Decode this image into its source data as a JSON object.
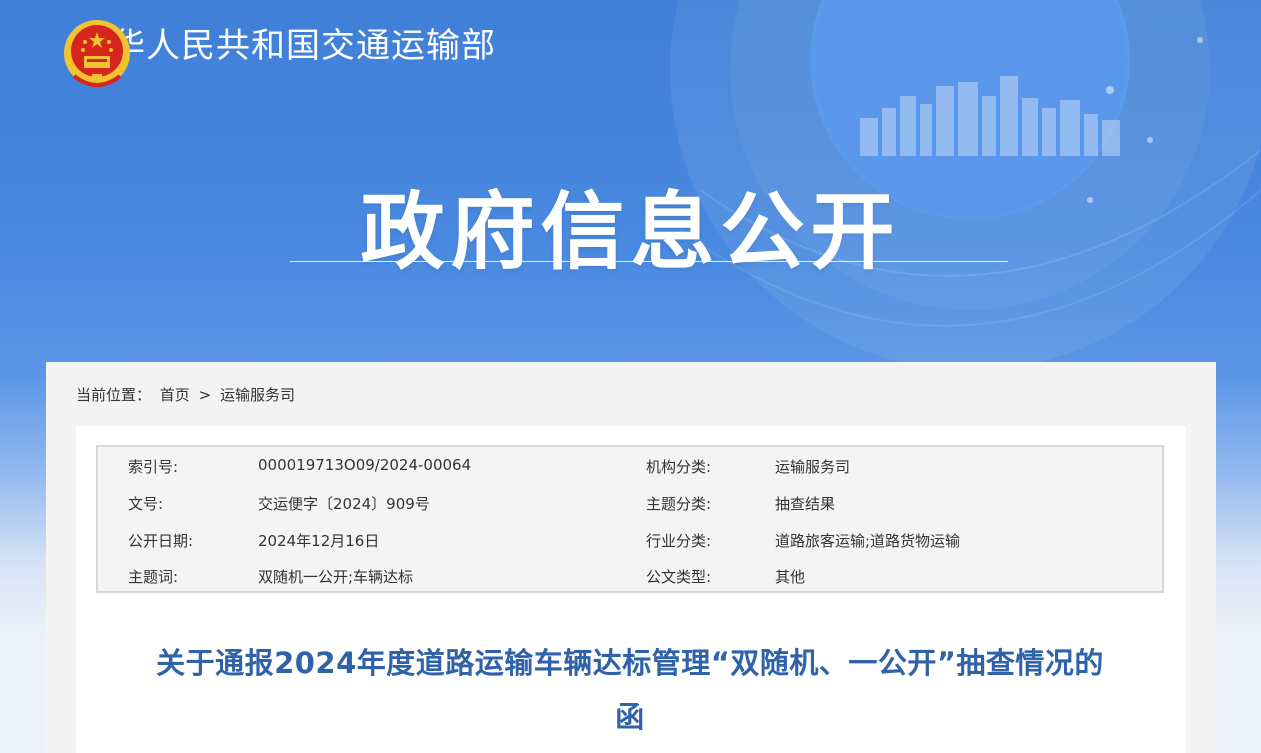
{
  "header": {
    "site_name": "中华人民共和国交通运输部",
    "banner_title": "政府信息公开"
  },
  "breadcrumb": {
    "label": "当前位置：",
    "home": "首页",
    "sep": ">",
    "current": "运输服务司"
  },
  "meta": {
    "rows": [
      {
        "k1": "索引号:",
        "v1": "000019713O09/2024-00064",
        "k2": "机构分类:",
        "v2": "运输服务司"
      },
      {
        "k1": "文号:",
        "v1": "交运便字〔2024〕909号",
        "k2": "主题分类:",
        "v2": "抽查结果"
      },
      {
        "k1": "公开日期:",
        "v1": "2024年12月16日",
        "k2": "行业分类:",
        "v2": "道路旅客运输;道路货物运输"
      },
      {
        "k1": "主题词:",
        "v1": "双随机一公开;车辆达标",
        "k2": "公文类型:",
        "v2": "其他"
      }
    ]
  },
  "article": {
    "title_line1": "关于通报2024年度道路运输车辆达标管理“双随机、一公开”抽查情况的",
    "title_line2": "函"
  },
  "colors": {
    "banner_blue": "#4a8ae0",
    "title_blue": "#2f62a8"
  }
}
